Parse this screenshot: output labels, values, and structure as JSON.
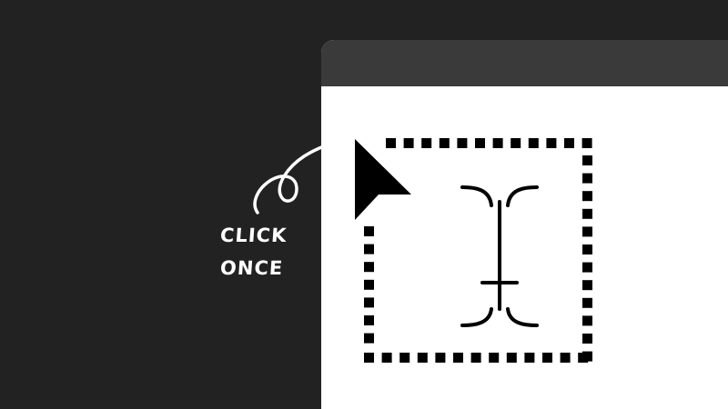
{
  "window": {
    "title": "",
    "colors": {
      "desktop": "#222222",
      "titlebar": "#3a3a3a",
      "content": "#ffffff",
      "ink": "#000000"
    }
  },
  "annotation": {
    "line1": "CLICK",
    "line2": "ONCE",
    "color": "#ffffff"
  },
  "icons": {
    "pointer": "arrow-pointer-icon",
    "text_cursor": "i-beam-text-cursor-icon",
    "selection": "dotted-text-box-outline"
  }
}
